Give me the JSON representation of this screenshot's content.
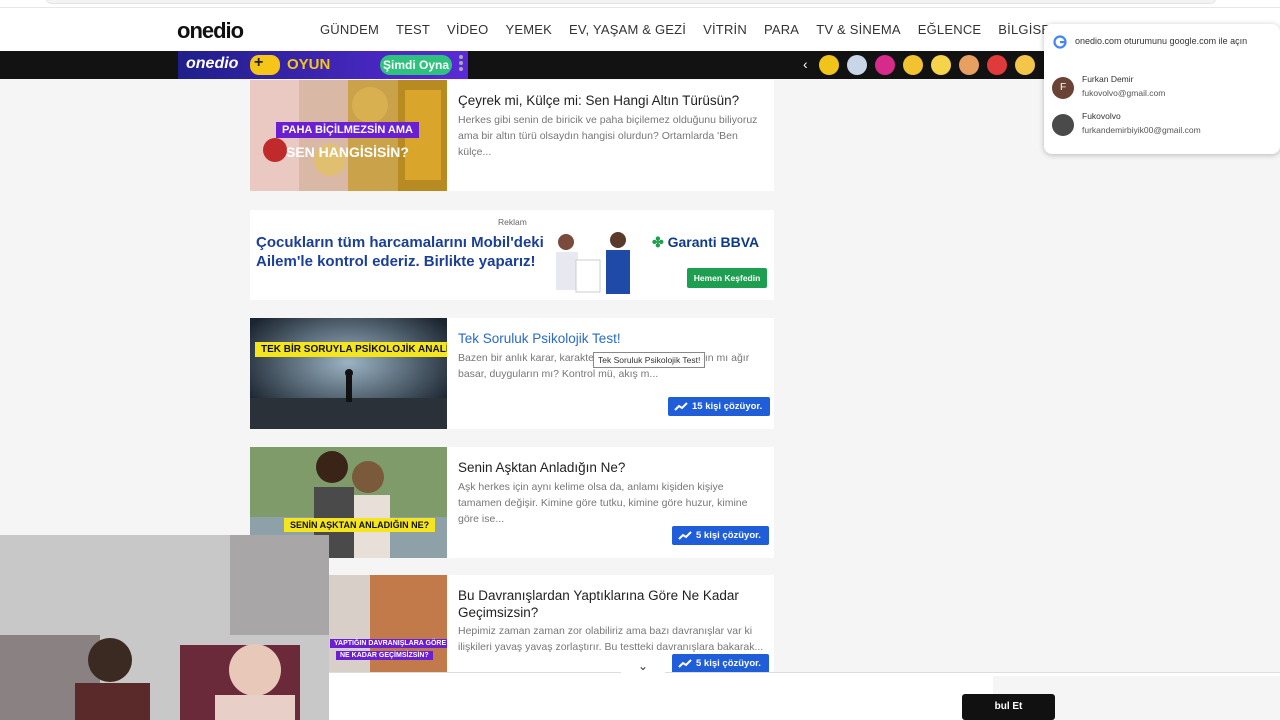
{
  "header": {
    "logo": "onedio",
    "nav": [
      "GÜNDEM",
      "TEST",
      "VİDEO",
      "YEMEK",
      "EV, YAŞAM & GEZİ",
      "VİTRİN",
      "PARA",
      "TV & SİNEMA",
      "EĞLENCE",
      "BİLGİSEL"
    ]
  },
  "gamebar": {
    "logo": "onedio",
    "oyun": "OYUN",
    "play": "Şimdi Oyna",
    "game_icons": [
      "#f0c419",
      "#c9d6e8",
      "#d62b8a",
      "#f2c230",
      "#f5d34a",
      "#e8a060",
      "#e03a3a",
      "#f3c64a"
    ]
  },
  "cards": [
    {
      "title": "Çeyrek mi, Külçe mi: Sen Hangi Altın Türüsün?",
      "desc": "Herkes gibi senin de biricik ve paha biçilemez olduğunu biliyoruz ama bir altın türü olsaydın hangisi olurdun? Ortamlarda 'Ben külçe...",
      "thumb_label_1": "PAHA BİÇİLMEZSİN AMA",
      "thumb_label_2": "SEN HANGİSİSİN?"
    },
    {
      "title": "Tek Soruluk Psikolojik Test!",
      "desc": "Bazen bir anlık karar, karakter         ortaya çıkarır... Mantığın mı ağır basar, duyguların mı? Kontrol mü, akış m...",
      "thumb_label": "TEK BİR SORUYLA PSİKOLOJİK ANALİZ!",
      "badge": "15 kişi çözüyor."
    },
    {
      "title": "Senin Aşktan Anladığın Ne?",
      "desc": "Aşk herkes için aynı kelime olsa da, anlamı kişiden kişiye tamamen değişir. Kimine göre tutku, kimine göre huzur, kimine göre ise...",
      "thumb_label": "SENİN AŞKTAN ANLADIĞIN NE?",
      "badge": "5 kişi çözüyor."
    },
    {
      "title": "Bu Davranışlardan Yaptıklarına Göre Ne Kadar Geçimsizsin?",
      "desc": "Hepimiz zaman zaman zor olabiliriz ama bazı davranışlar var ki ilişkileri yavaş yavaş zorlaştırır. Bu testteki davranışlara bakarak...",
      "thumb_label_1": "YAPTIĞIN DAVRANIŞLARA GÖRE",
      "thumb_label_2": "NE KADAR GEÇİMSİZSİN?",
      "badge": "5 kişi çözüyor."
    }
  ],
  "ad": {
    "label": "Reklam",
    "text": "Çocukların tüm harcamalarını Mobil'deki Ailem'le kontrol ederiz. Birlikte yaparız!",
    "bank": "Garanti BBVA",
    "cta": "Hemen Keşfedin"
  },
  "tooltip": "Tek Soruluk Psikolojik Test!",
  "google_popup": {
    "title": "onedio.com oturumunu google.com ile açın",
    "accounts": [
      {
        "initial": "F",
        "name": "Furkan Demir",
        "email": "fukovolvo@gmail.com"
      },
      {
        "initial": "",
        "name": "Fukovolvo",
        "email": "furkandemirbiyik00@gmail.com"
      }
    ]
  },
  "cookie": {
    "accept": "bul Et"
  }
}
